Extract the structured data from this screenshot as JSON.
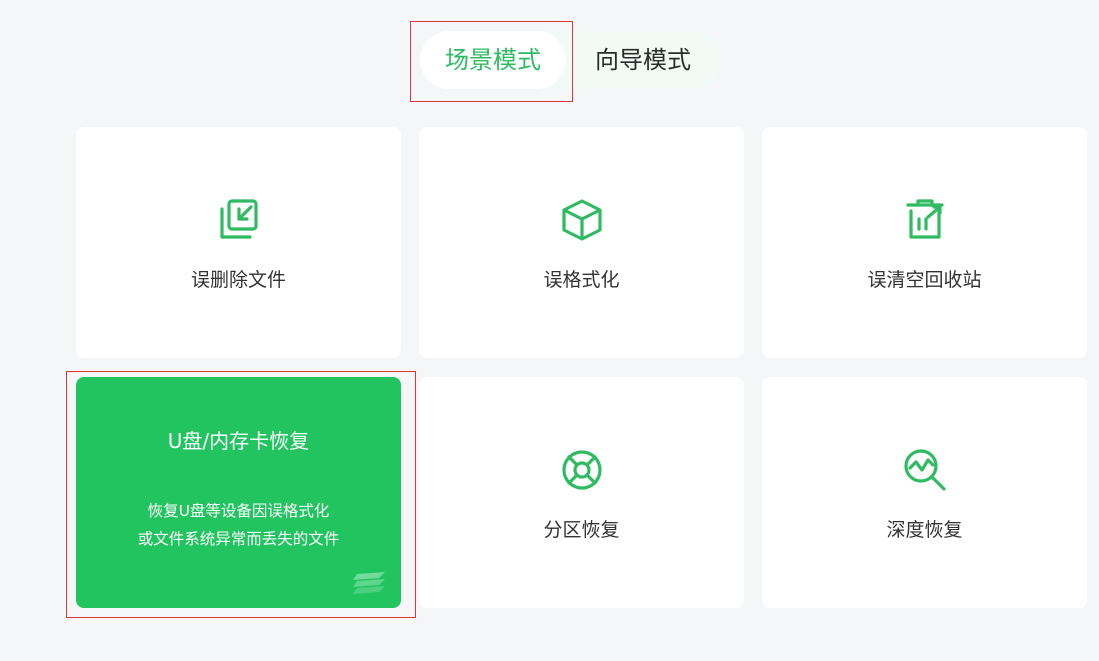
{
  "mode_switch": {
    "active_label": "场景模式",
    "inactive_label": "向导模式"
  },
  "cards": [
    {
      "label": "误删除文件",
      "icon": "deleted-file-icon"
    },
    {
      "label": "误格式化",
      "icon": "format-box-icon"
    },
    {
      "label": "误清空回收站",
      "icon": "recycle-bin-icon"
    },
    {
      "label": "分区恢复",
      "icon": "partition-lifebuoy-icon"
    },
    {
      "label": "深度恢复",
      "icon": "deep-scan-magnifier-icon"
    }
  ],
  "active_card": {
    "title": "U盘/内存卡恢复",
    "desc_line1": "恢复U盘等设备因误格式化",
    "desc_line2": "或文件系统异常而丢失的文件",
    "icon": "layers-stack-icon"
  },
  "colors": {
    "accent": "#2fbb62",
    "card_active": "#22c460",
    "highlight": "#d9363e",
    "background": "#f5f6f7"
  }
}
